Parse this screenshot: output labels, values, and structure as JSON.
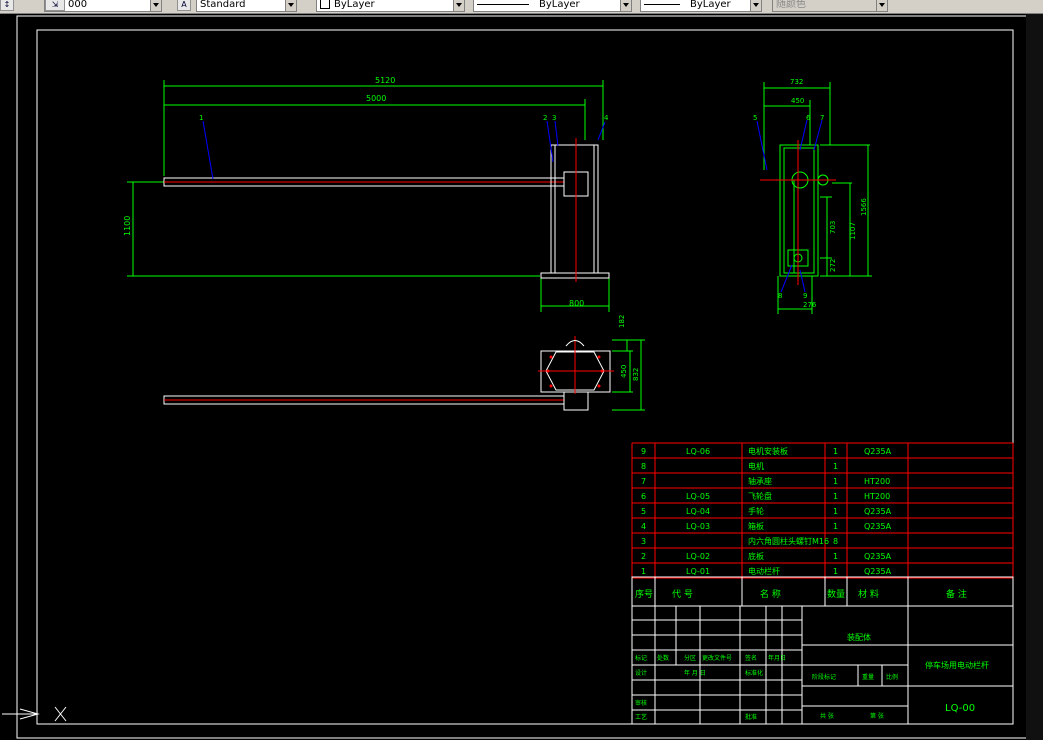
{
  "toolbar": {
    "text_height_value": "000",
    "text_style": "Standard",
    "layer": "ByLayer",
    "linetype": "ByLayer",
    "lineweight": "ByLayer",
    "plot_style": "随颜色"
  },
  "colors": {
    "background": "#000000",
    "frame": "#ffffff",
    "dimension": "#00ff00",
    "centerline": "#ff0000",
    "leader": "#0000ff",
    "table_line": "#ff0000",
    "table_text": "#00ff00"
  },
  "drawing": {
    "front_view": {
      "dims": {
        "overall": "5120",
        "length": "5000",
        "height": "1100",
        "base": "800"
      },
      "balloons": [
        "1",
        "2",
        "3",
        "4"
      ]
    },
    "side_view": {
      "dims": {
        "width_top": "732",
        "width_inner": "450",
        "h1": "703",
        "h2": "1107",
        "h3": "1566",
        "h4": "272",
        "bottom": "276"
      },
      "balloons": [
        "5",
        "6",
        "7",
        "8",
        "9"
      ]
    },
    "top_view": {
      "dims": {
        "d1": "182",
        "d2": "450",
        "d3": "832"
      }
    }
  },
  "bom": {
    "rows": [
      {
        "no": "9",
        "code": "LQ-06",
        "name": "电机安装板",
        "qty": "1",
        "material": "Q235A",
        "note": ""
      },
      {
        "no": "8",
        "code": "",
        "name": "电机",
        "qty": "1",
        "material": "",
        "note": ""
      },
      {
        "no": "7",
        "code": "",
        "name": "轴承座",
        "qty": "1",
        "material": "HT200",
        "note": ""
      },
      {
        "no": "6",
        "code": "LQ-05",
        "name": "飞轮盘",
        "qty": "1",
        "material": "HT200",
        "note": ""
      },
      {
        "no": "5",
        "code": "LQ-04",
        "name": "手轮",
        "qty": "1",
        "material": "Q235A",
        "note": ""
      },
      {
        "no": "4",
        "code": "LQ-03",
        "name": "箱板",
        "qty": "1",
        "material": "Q235A",
        "note": ""
      },
      {
        "no": "3",
        "code": "",
        "name": "内六角圆柱头螺钉M16",
        "qty": "8",
        "material": "",
        "note": ""
      },
      {
        "no": "2",
        "code": "LQ-02",
        "name": "底板",
        "qty": "1",
        "material": "Q235A",
        "note": ""
      },
      {
        "no": "1",
        "code": "LQ-01",
        "name": "电动栏杆",
        "qty": "1",
        "material": "Q235A",
        "note": ""
      }
    ],
    "headers": {
      "no": "序号",
      "code": "代  号",
      "name": "名  称",
      "qty": "数量",
      "material": "材  料",
      "note": "备  注"
    }
  },
  "title_block": {
    "assembly": "装配体",
    "title": "停车场用电动栏杆",
    "drawing_no": "LQ-00",
    "labels": {
      "mark": "标记",
      "count": "处数",
      "zone": "分区",
      "change_doc": "更改文件号",
      "sign": "签名",
      "date": "年月日",
      "design": "设计",
      "std": "标准化",
      "stage_mark": "阶段标记",
      "weight": "重量",
      "scale": "比例",
      "review": "审核",
      "process": "工艺",
      "approve": "批准",
      "sheets": "共  张",
      "sheet": "第  张",
      "date2": "年  月  日"
    }
  }
}
